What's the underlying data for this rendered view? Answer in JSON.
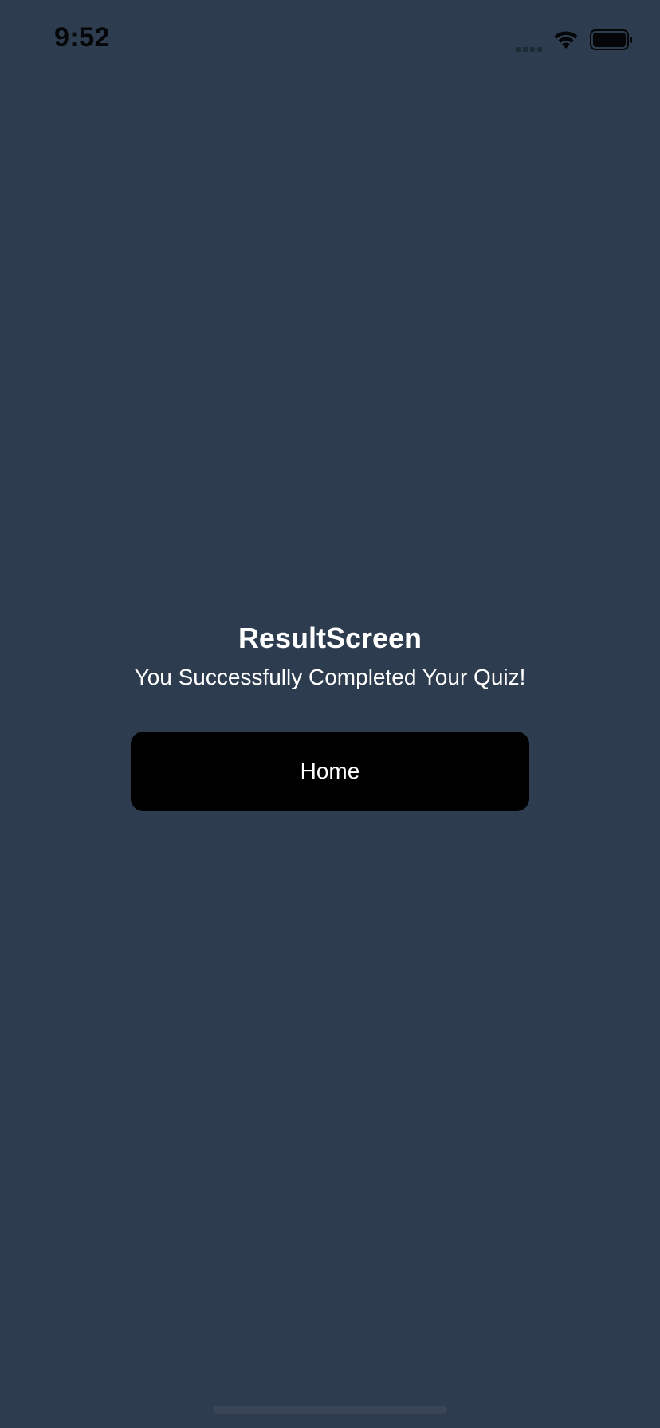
{
  "status_bar": {
    "time": "9:52",
    "icons": [
      "signal-icon",
      "wifi-icon",
      "battery-icon"
    ]
  },
  "content": {
    "title": "ResultScreen",
    "subtitle": "You Successfully Completed Your Quiz!",
    "home_button_label": "Home"
  },
  "colors": {
    "background": "#2d3c4f",
    "button_background": "#000000",
    "text": "#ffffff"
  }
}
